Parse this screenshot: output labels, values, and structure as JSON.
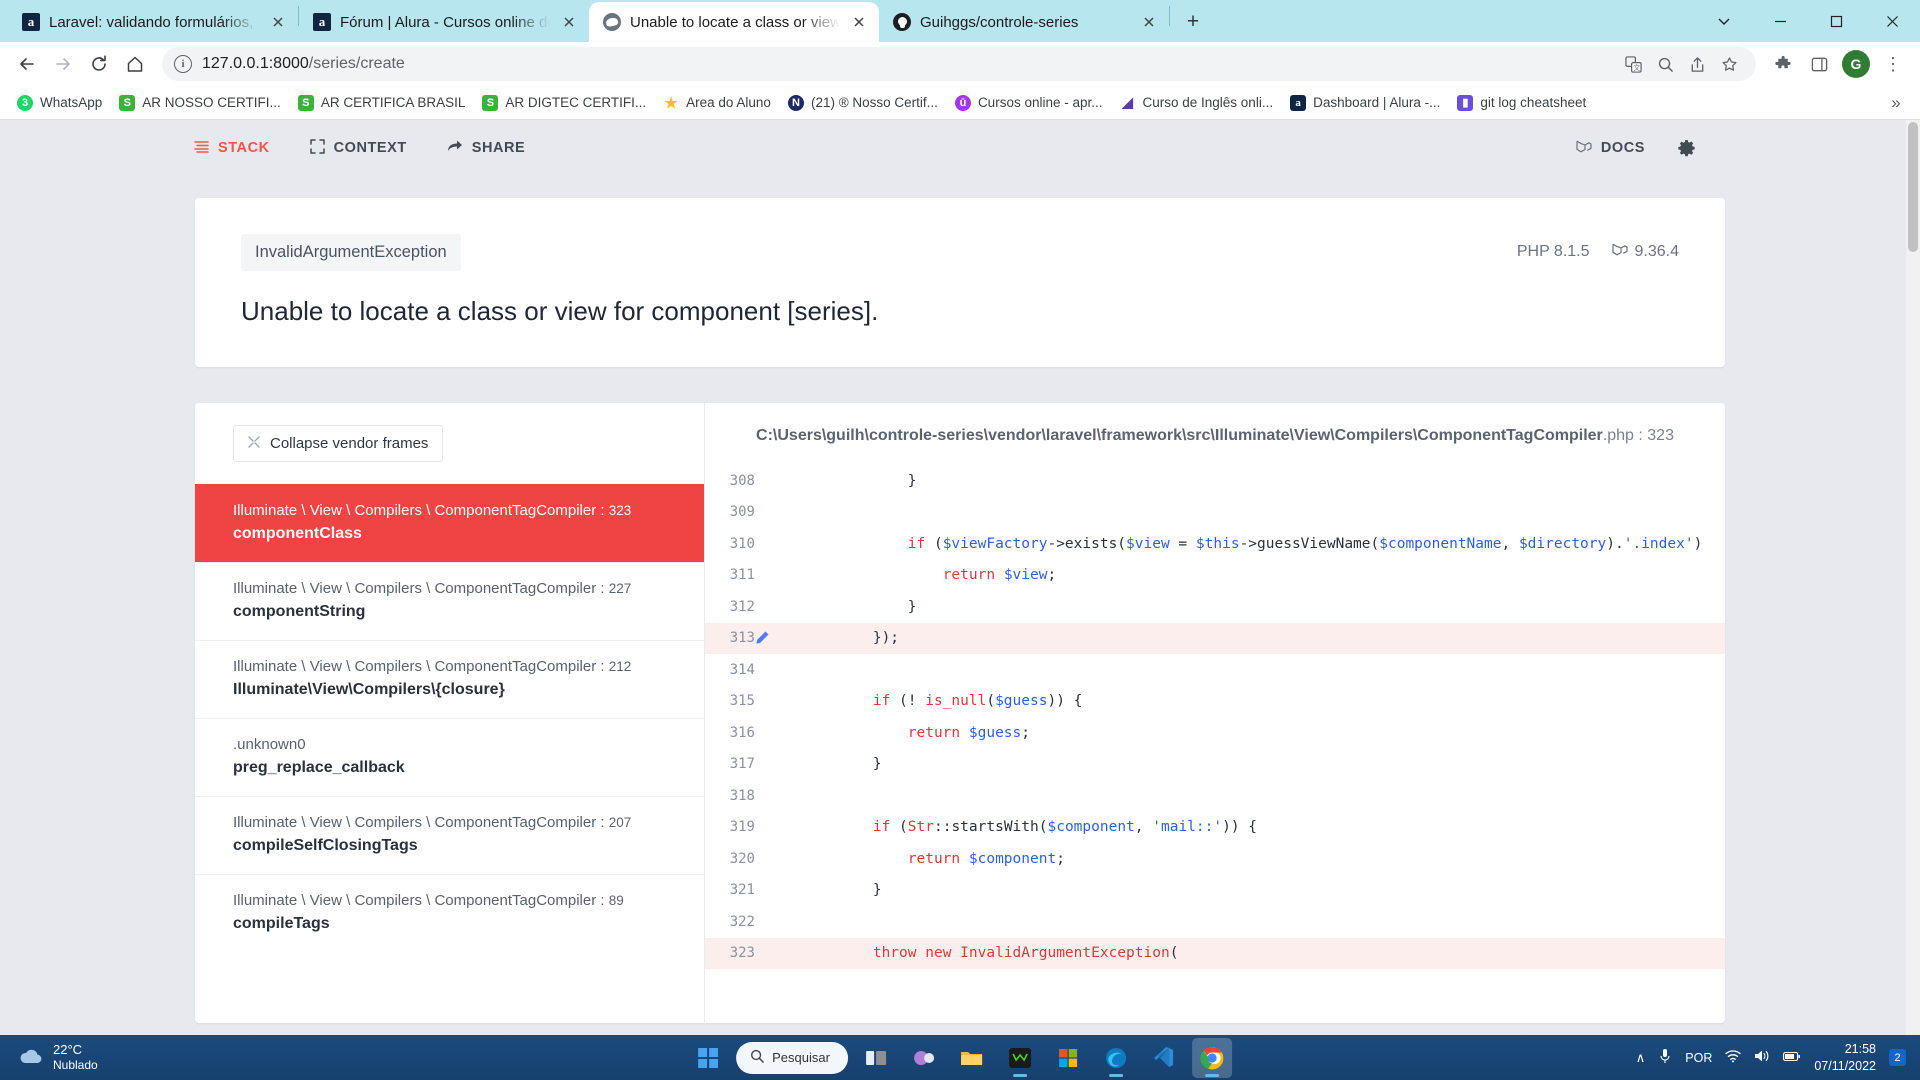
{
  "browser": {
    "tabs": [
      {
        "title": "Laravel: validando formulários, us",
        "favicon": "alura-icon",
        "active": false
      },
      {
        "title": "Fórum | Alura - Cursos online de",
        "favicon": "alura-icon",
        "active": false
      },
      {
        "title": "Unable to locate a class or view f",
        "favicon": "flare-icon",
        "active": true
      },
      {
        "title": "Guihggs/controle-series",
        "favicon": "github-icon",
        "active": false
      }
    ],
    "new_tab_label": "+",
    "window_controls": {
      "minimize": "–",
      "maximize": "□",
      "close": "✕",
      "more": "⌄"
    },
    "toolbar": {
      "back": "←",
      "forward": "→",
      "reload": "↻",
      "home": "⌂",
      "url_host": "127.0.0.1:8000",
      "url_path": "/series/create",
      "site_info": "i",
      "translate": "translate-icon",
      "zoom_search": "search-icon",
      "share": "share-icon",
      "bookmark": "star-icon",
      "extensions": "puzzle-icon",
      "sidepanel": "panel-icon",
      "profile_initial": "G",
      "menu": "⋮"
    },
    "bookmarks": [
      {
        "label": "WhatsApp",
        "icon": "whatsapp-icon",
        "color": "#25d366"
      },
      {
        "label": "AR NOSSO CERTIFI...",
        "icon": "ar-icon",
        "color": "#3db13d"
      },
      {
        "label": "AR CERTIFICA BRASIL",
        "icon": "ar-icon",
        "color": "#3db13d"
      },
      {
        "label": "AR DIGTEC CERTIFI...",
        "icon": "ar-icon",
        "color": "#3db13d"
      },
      {
        "label": "Area do Aluno",
        "icon": "star-icon",
        "color": "#f5bf2a"
      },
      {
        "label": "(21) ® Nosso Certif...",
        "icon": "nosso-icon",
        "color": "#1d2b63"
      },
      {
        "label": "Cursos online - apr...",
        "icon": "udemy-icon",
        "color": "#a435f0"
      },
      {
        "label": "Curso de Inglês onli...",
        "icon": "ingles-icon",
        "color": "#5b3fa0"
      },
      {
        "label": "Dashboard | Alura -...",
        "icon": "alura-icon",
        "color": "#10253f"
      },
      {
        "label": "git log cheatsheet",
        "icon": "doc-icon",
        "color": "#6c4fd8"
      }
    ],
    "bookmarks_overflow": "»"
  },
  "ignition": {
    "nav": {
      "tabs": [
        {
          "label": "STACK",
          "icon": "stack-icon",
          "active": true
        },
        {
          "label": "CONTEXT",
          "icon": "context-icon",
          "active": false
        },
        {
          "label": "SHARE",
          "icon": "share-icon",
          "active": false
        }
      ],
      "docs_label": "DOCS",
      "docs_icon": "laravel-icon",
      "settings_icon": "gear-icon"
    },
    "exception": {
      "name": "InvalidArgumentException",
      "message": "Unable to locate a class or view for component [series].",
      "php_version": "PHP 8.1.5",
      "laravel_version": "9.36.4"
    },
    "collapse_button": "Collapse vendor frames",
    "collapse_icon": "collapse-icon",
    "frames": [
      {
        "location": "Illuminate \\ View \\ Compilers \\ ComponentTagCompiler",
        "line": "323",
        "method": "componentClass",
        "selected": true
      },
      {
        "location": "Illuminate \\ View \\ Compilers \\ ComponentTagCompiler",
        "line": "227",
        "method": "componentString",
        "selected": false
      },
      {
        "location": "Illuminate \\ View \\ Compilers \\ ComponentTagCompiler",
        "line": "212",
        "method": "Illuminate\\View\\Compilers\\{closure}",
        "selected": false
      },
      {
        "location": ".unknown0",
        "line": "",
        "method": "preg_replace_callback",
        "selected": false
      },
      {
        "location": "Illuminate \\ View \\ Compilers \\ ComponentTagCompiler",
        "line": "207",
        "method": "compileSelfClosingTags",
        "selected": false
      },
      {
        "location": "Illuminate \\ View \\ Compilers \\ ComponentTagCompiler",
        "line": "89",
        "method": "compileTags",
        "selected": false
      }
    ],
    "code": {
      "file_path": "C:\\Users\\guilh\\controle-series\\vendor\\laravel\\framework\\src\\Illuminate\\View\\Compilers\\ComponentTagCompiler",
      "file_ext": ".php",
      "file_line": "323",
      "lines": [
        {
          "num": "308",
          "highlight": false,
          "pencil": false
        },
        {
          "num": "309",
          "highlight": false,
          "pencil": false
        },
        {
          "num": "310",
          "highlight": false,
          "pencil": false
        },
        {
          "num": "311",
          "highlight": false,
          "pencil": false
        },
        {
          "num": "312",
          "highlight": false,
          "pencil": false
        },
        {
          "num": "313",
          "highlight": true,
          "pencil": true
        },
        {
          "num": "314",
          "highlight": false,
          "pencil": false
        },
        {
          "num": "315",
          "highlight": false,
          "pencil": false
        },
        {
          "num": "316",
          "highlight": false,
          "pencil": false
        },
        {
          "num": "317",
          "highlight": false,
          "pencil": false
        },
        {
          "num": "318",
          "highlight": false,
          "pencil": false
        },
        {
          "num": "319",
          "highlight": false,
          "pencil": false
        },
        {
          "num": "320",
          "highlight": false,
          "pencil": false
        },
        {
          "num": "321",
          "highlight": false,
          "pencil": false
        },
        {
          "num": "322",
          "highlight": false,
          "pencil": false
        },
        {
          "num": "323",
          "highlight": true,
          "pencil": false
        }
      ],
      "line_text": {
        "308": "            }",
        "309": "",
        "310": "            if ($viewFactory->exists($view = $this->guessViewName($componentName, $directory).'.index')",
        "311": "                return $view;",
        "312": "            }",
        "313": "        });",
        "314": "",
        "315": "        if (! is_null($guess)) {",
        "316": "            return $guess;",
        "317": "        }",
        "318": "",
        "319": "        if (Str::startsWith($component, 'mail::')) {",
        "320": "            return $component;",
        "321": "        }",
        "322": "",
        "323": "        throw new InvalidArgumentException("
      }
    }
  },
  "taskbar": {
    "weather": {
      "temperature": "22°C",
      "condition": "Nublado",
      "icon": "cloud-icon"
    },
    "start_icon": "windows-icon",
    "search_placeholder": "Pesquisar",
    "search_icon": "search-icon",
    "apps": [
      {
        "name": "task-view-icon"
      },
      {
        "name": "teams-icon"
      },
      {
        "name": "file-explorer-icon"
      },
      {
        "name": "razer-icon"
      },
      {
        "name": "microsoft-store-icon"
      },
      {
        "name": "edge-icon"
      },
      {
        "name": "vscode-icon"
      },
      {
        "name": "chrome-icon"
      }
    ],
    "tray": {
      "chevron": "∧",
      "mic": "mic-icon",
      "language": "POR",
      "wifi": "wifi-icon",
      "volume": "volume-icon",
      "battery": "battery-icon"
    },
    "clock": {
      "time": "21:58",
      "date": "07/11/2022"
    },
    "notification_count": "2"
  }
}
